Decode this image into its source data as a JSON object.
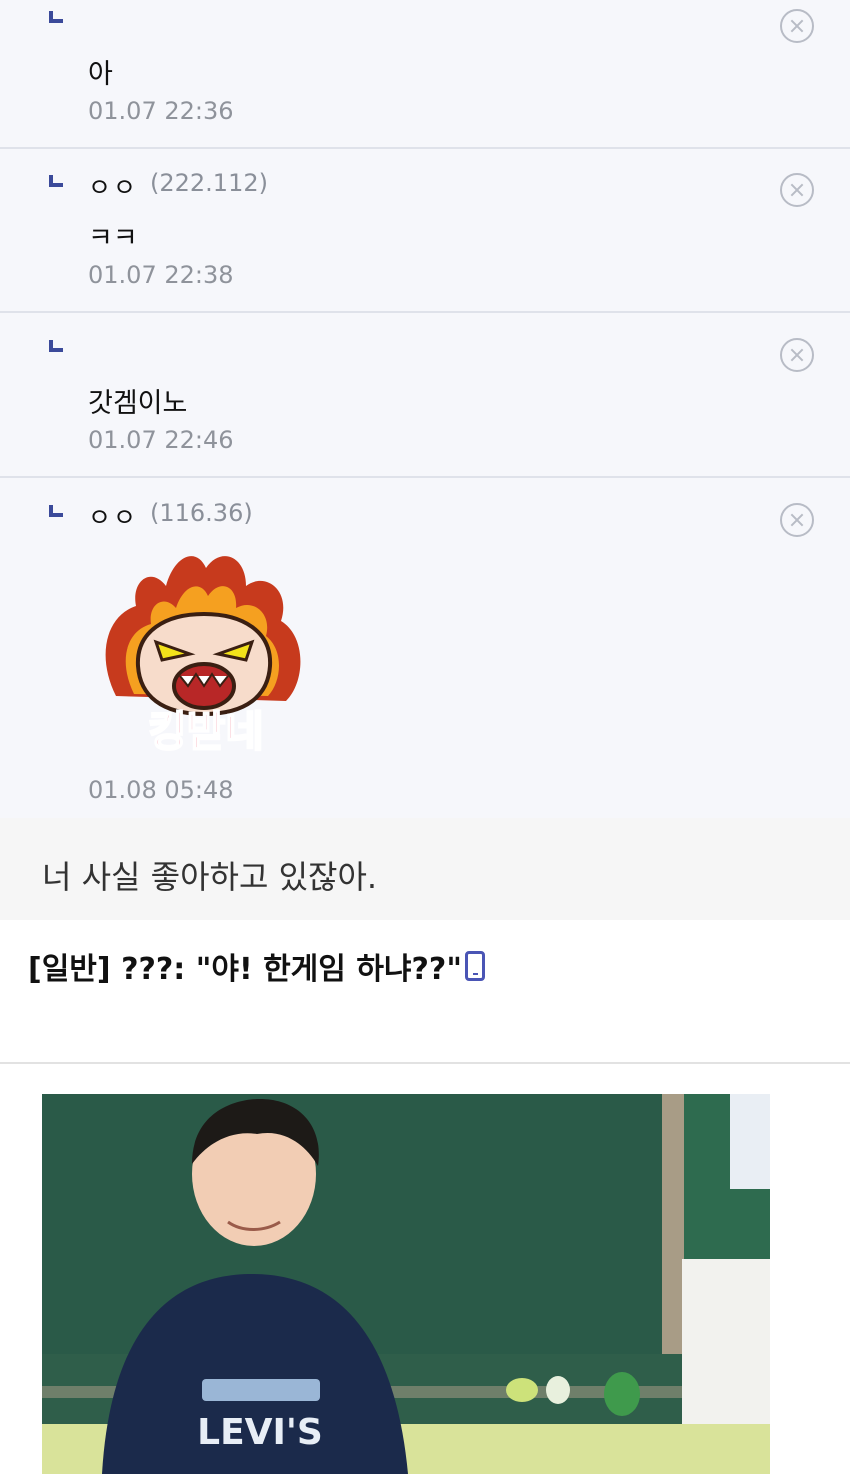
{
  "comments": [
    {
      "nick": "",
      "ip": "",
      "text": "아",
      "time": "01.07 22:36"
    },
    {
      "nick": "ㅇㅇ",
      "ip": "(222.112)",
      "text": "ㅋㅋ",
      "time": "01.07 22:38"
    },
    {
      "nick": "",
      "ip": "",
      "text": "갓겜이노",
      "time": "01.07 22:46"
    },
    {
      "nick": "ㅇㅇ",
      "ip": "(116.36)",
      "sticker_text": "킹받네",
      "time": "01.08 05:48"
    }
  ],
  "tagline": "너 사실 좋아하고 있잖아.",
  "post": {
    "title": "[일반] ???: \"야! 한게임 하냐??\"",
    "shirt_text": "LEVI'S"
  },
  "colors": {
    "reply_mark": "#3b4a9a",
    "comment_bg": "#f6f7fb",
    "phone_icon": "#4a55b5"
  }
}
